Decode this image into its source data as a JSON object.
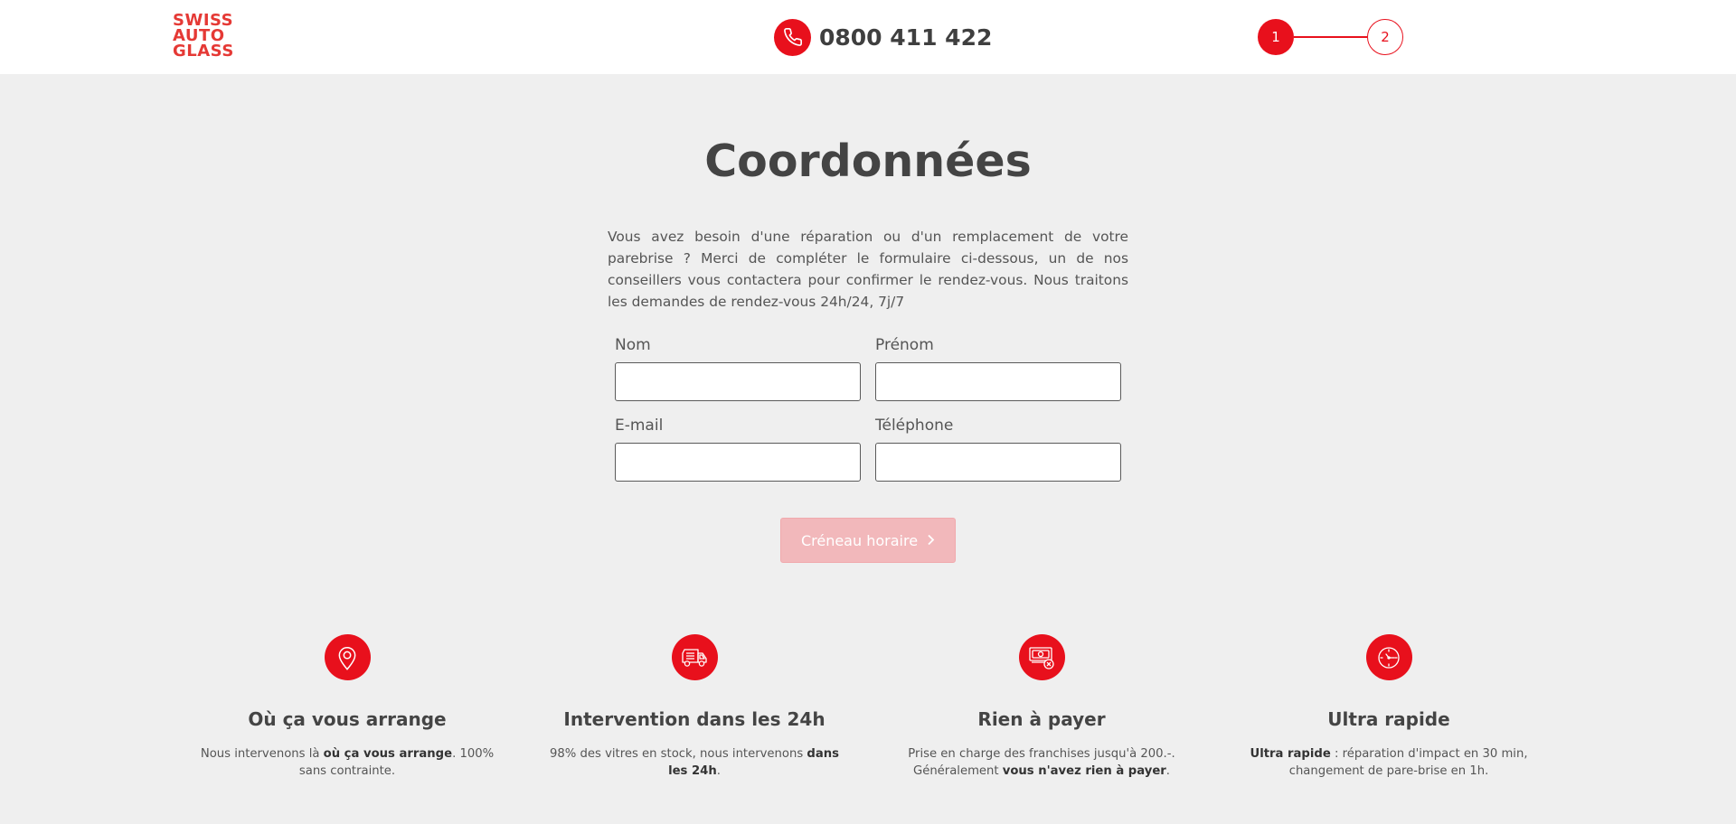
{
  "header": {
    "logo": {
      "line1": "SWISS",
      "line2": "AUTO",
      "line3": "GLASS"
    },
    "phone": {
      "icon": "phone-icon",
      "number": "0800 411 422"
    },
    "stepper": {
      "step1": "1",
      "step2": "2"
    }
  },
  "form": {
    "title": "Coordonnées",
    "intro": "Vous avez besoin d'une réparation ou d'un remplacement de votre parebrise ? Merci de compléter le formulaire ci-dessous, un de nos conseillers vous contactera pour confirmer le rendez-vous. Nous traitons les demandes de rendez-vous 24h/24, 7j/7",
    "fields": {
      "nom": {
        "label": "Nom",
        "value": ""
      },
      "prenom": {
        "label": "Prénom",
        "value": ""
      },
      "email": {
        "label": "E-mail",
        "value": ""
      },
      "telephone": {
        "label": "Téléphone",
        "value": ""
      }
    },
    "submit_label": "Créneau horaire"
  },
  "features": [
    {
      "icon": "location-pin-icon",
      "title": "Où ça vous arrange",
      "desc_pre": "Nous intervenons là ",
      "desc_bold": "où ça vous arrange",
      "desc_post": ". 100% sans contrainte."
    },
    {
      "icon": "truck-icon",
      "title": "Intervention dans les 24h",
      "desc_pre": "98% des vitres en stock, nous intervenons ",
      "desc_bold": "dans les 24h",
      "desc_post": "."
    },
    {
      "icon": "money-icon",
      "title": "Rien à payer",
      "desc_pre": "Prise en charge des franchises jusqu'à 200.-. Généralement ",
      "desc_bold": "vous n'avez rien à payer",
      "desc_post": "."
    },
    {
      "icon": "clock-icon",
      "title": "Ultra rapide",
      "desc_pre": "",
      "desc_bold": "Ultra rapide",
      "desc_post": " : réparation d'impact en 30 min, changement de pare-brise en 1h."
    }
  ],
  "colors": {
    "accent": "#e8101c",
    "logo": "#e53935",
    "background": "#efefef",
    "button_disabled": "#f2b8bb"
  }
}
